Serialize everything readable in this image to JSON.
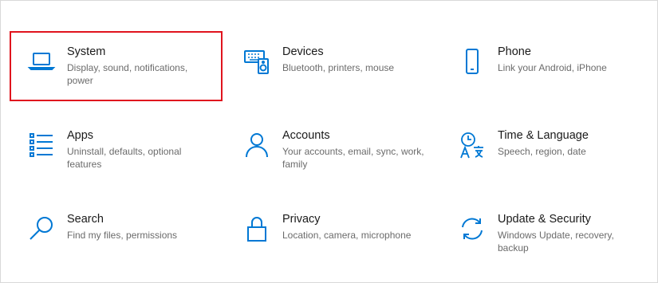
{
  "accent_color": "#0078d4",
  "highlight_color": "#e0141e",
  "tiles": [
    {
      "title": "System",
      "desc": "Display, sound, notifications, power",
      "icon": "laptop-icon"
    },
    {
      "title": "Devices",
      "desc": "Bluetooth, printers, mouse",
      "icon": "keyboard-speaker-icon"
    },
    {
      "title": "Phone",
      "desc": "Link your Android, iPhone",
      "icon": "phone-icon"
    },
    {
      "title": "Apps",
      "desc": "Uninstall, defaults, optional features",
      "icon": "apps-list-icon"
    },
    {
      "title": "Accounts",
      "desc": "Your accounts, email, sync, work, family",
      "icon": "person-icon"
    },
    {
      "title": "Time & Language",
      "desc": "Speech, region, date",
      "icon": "time-language-icon"
    },
    {
      "title": "Search",
      "desc": "Find my files, permissions",
      "icon": "search-icon"
    },
    {
      "title": "Privacy",
      "desc": "Location, camera, microphone",
      "icon": "lock-icon"
    },
    {
      "title": "Update & Security",
      "desc": "Windows Update, recovery, backup",
      "icon": "sync-icon"
    }
  ]
}
